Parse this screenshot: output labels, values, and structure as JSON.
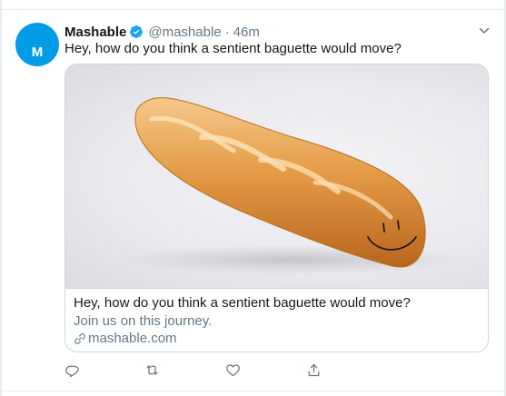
{
  "tweet": {
    "author_name": "Mashable",
    "avatar_letter": "M",
    "handle": "@mashable",
    "separator": "·",
    "time": "46m",
    "text": "Hey, how do you think a sentient baguette would move?"
  },
  "card": {
    "title": "Hey, how do you think a sentient baguette would move?",
    "description": "Join us on this journey.",
    "domain": "mashable.com",
    "image_subject": "baguette-with-drawn-smiley-face"
  },
  "actions": [
    {
      "icon": "reply-icon"
    },
    {
      "icon": "retweet-icon"
    },
    {
      "icon": "like-icon"
    },
    {
      "icon": "share-icon"
    }
  ],
  "colors": {
    "brand_blue": "#1da1f2",
    "avatar_bg": "#009ce8",
    "secondary_text": "#657786",
    "border": "#ccd6dd"
  }
}
